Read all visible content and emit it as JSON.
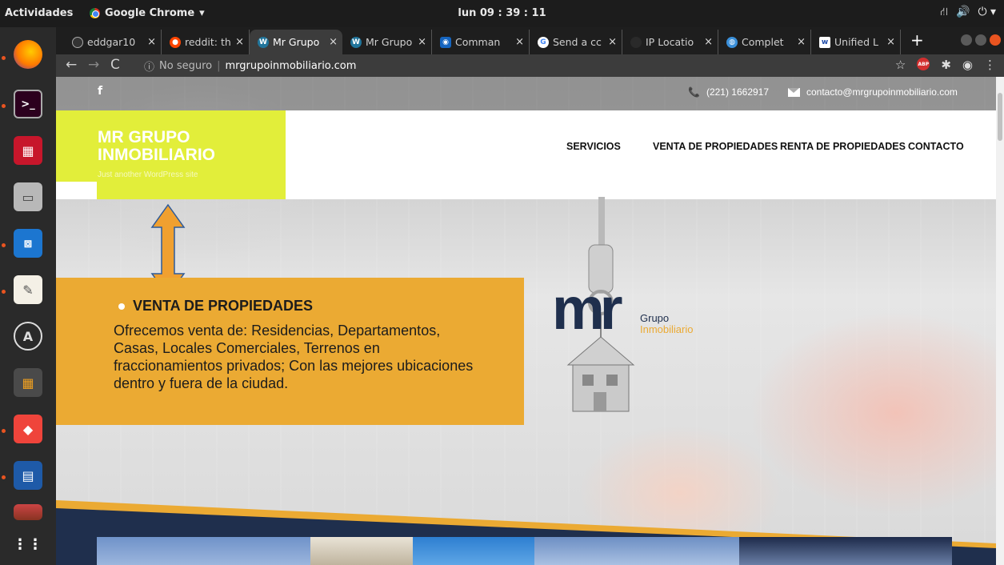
{
  "system": {
    "activities": "Actividades",
    "app_name": "Google Chrome",
    "app_menu_icon": "chevron-down-icon",
    "clock": "lun 09 : 39 : 11",
    "tray_icons": [
      "network-icon",
      "volume-icon",
      "power-icon"
    ]
  },
  "dock": {
    "items": [
      "firefox-icon",
      "terminal-icon",
      "system-monitor-icon",
      "archive-icon",
      "virtualbox-icon",
      "text-editor-icon",
      "software-updater-icon",
      "calculator-icon",
      "anydesk-icon",
      "libreoffice-writer-icon",
      "gaming-icon",
      "app-grid-icon"
    ]
  },
  "browser": {
    "tabs": [
      {
        "label": "eddgar10",
        "icon": "github-icon",
        "active": false
      },
      {
        "label": "reddit: th",
        "icon": "reddit-icon",
        "active": false
      },
      {
        "label": "Mr Grupo",
        "icon": "wordpress-icon",
        "active": true
      },
      {
        "label": "Mr Grupo",
        "icon": "wordpress-icon",
        "active": false
      },
      {
        "label": "Comman",
        "icon": "terminal-site-icon",
        "active": false
      },
      {
        "label": "Send a cc",
        "icon": "google-icon",
        "active": false
      },
      {
        "label": "IP Locatio",
        "icon": "ip-icon",
        "active": false
      },
      {
        "label": "Complet",
        "icon": "globe-icon",
        "active": false
      },
      {
        "label": "Unified L",
        "icon": "wordpress-w-icon",
        "active": false
      }
    ],
    "new_tab": "+",
    "security_label": "No seguro",
    "url": "mrgrupoinmobiliario.com",
    "nav_icons": [
      "back-icon",
      "forward-icon",
      "reload-icon",
      "info-icon",
      "star-icon",
      "adblock-icon",
      "extensions-icon",
      "profile-icon",
      "menu-icon"
    ],
    "adblock_text": "ABP"
  },
  "site": {
    "facebook": "f",
    "phone": "(221) 1662917",
    "email": "contacto@mrgrupoinmobiliario.com",
    "logo_title": "MR GRUPO INMOBILIARIO",
    "tagline": "Just another WordPress site",
    "menu": [
      "SERVICIOS",
      "VENTA DE PROPIEDADES",
      "RENTA DE PROPIEDADES",
      "CONTACTO"
    ],
    "info_heading": "VENTA DE PROPIEDADES",
    "info_body": "Ofrecemos venta de: Residencias, Departamentos, Casas, Locales Comerciales, Terrenos en fraccionamientos privados; Con las mejores ubicaciones dentro y fuera de la ciudad.",
    "brand_mark": "mr",
    "brand_line1": "Grupo",
    "brand_line2": "Inmobiliario",
    "colors": {
      "accent_yellow": "#e2ee3a",
      "accent_orange": "#ebaa33",
      "brand_navy": "#1f2f4d"
    }
  }
}
